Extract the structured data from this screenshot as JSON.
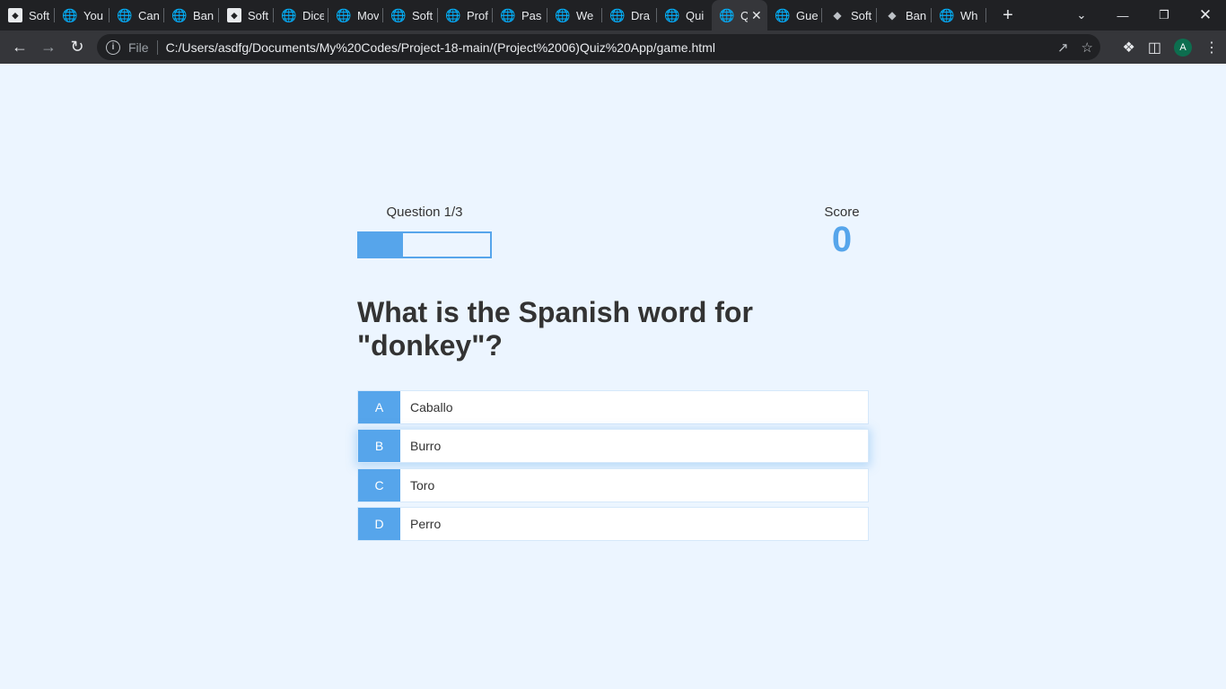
{
  "browser": {
    "tabs": [
      {
        "title": "Soft",
        "icon": "soft-logo-icon"
      },
      {
        "title": "You",
        "icon": "globe-icon"
      },
      {
        "title": "Can",
        "icon": "globe-icon"
      },
      {
        "title": "Ban",
        "icon": "globe-icon"
      },
      {
        "title": "Soft",
        "icon": "soft-logo-icon"
      },
      {
        "title": "Dice",
        "icon": "globe-icon"
      },
      {
        "title": "Mov",
        "icon": "globe-icon"
      },
      {
        "title": "Soft",
        "icon": "globe-icon"
      },
      {
        "title": "Prof",
        "icon": "globe-icon"
      },
      {
        "title": "Pas",
        "icon": "globe-icon"
      },
      {
        "title": "We",
        "icon": "globe-icon"
      },
      {
        "title": "Dra",
        "icon": "globe-icon"
      },
      {
        "title": "Qui",
        "icon": "globe-icon"
      },
      {
        "title": "Q",
        "icon": "globe-icon",
        "active": true
      },
      {
        "title": "Gue",
        "icon": "globe-icon"
      },
      {
        "title": "Soft",
        "icon": "soft-dark-icon"
      },
      {
        "title": "Ban",
        "icon": "soft-dark-icon"
      },
      {
        "title": "Wh",
        "icon": "globe-icon"
      }
    ],
    "file_label": "File",
    "url": "C:/Users/asdfg/Documents/My%20Codes/Project-18-main/(Project%2006)Quiz%20App/game.html",
    "avatar_letter": "A"
  },
  "hud": {
    "question_counter": "Question 1/3",
    "progress_fraction": 0.333,
    "score_label": "Score",
    "score_value": "0"
  },
  "question": "What is the Spanish word for \"donkey\"?",
  "choices": [
    {
      "prefix": "A",
      "text": "Caballo"
    },
    {
      "prefix": "B",
      "text": "Burro",
      "hovered": true
    },
    {
      "prefix": "C",
      "text": "Toro"
    },
    {
      "prefix": "D",
      "text": "Perro"
    }
  ],
  "colors": {
    "accent": "#56a5eb",
    "page_bg": "#ecf5ff",
    "text": "#333333"
  }
}
